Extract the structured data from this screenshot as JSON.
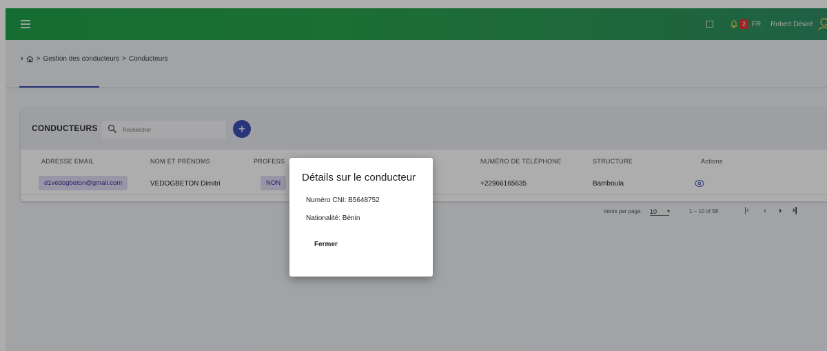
{
  "topbar": {
    "notif_count": "2",
    "lang": "FR",
    "user_name": "Robert Désiré"
  },
  "breadcrumb": {
    "sep": ">",
    "item1": "Gestion des conducteurs",
    "item2": "Conducteurs"
  },
  "card": {
    "title": "CONDUCTEURS",
    "search_placeholder": "Rechercher",
    "add_label": "+"
  },
  "table": {
    "headers": [
      "ADRESSE EMAIL",
      "NOM ET PRÉNOMS",
      "PROFESS",
      "NUMÉRO DE TÉLÉPHONE",
      "STRUCTURE",
      "Actions"
    ],
    "rows": [
      {
        "email": "d1vedogbeton@gmail.com",
        "name": "VEDOGBETON Dimitri",
        "prof": "NON",
        "phone": "+22966165635",
        "structure": "Bamboula"
      }
    ]
  },
  "paginator": {
    "items_per_page_label": "Items per page:",
    "page_size": "10",
    "range": "1 – 10 of 58"
  },
  "dialog": {
    "title": "Détails sur le conducteur",
    "cni": "Numéro CNI: B5648752",
    "nationality": "Nationalité: Bénin",
    "close_label": "Fermer"
  }
}
